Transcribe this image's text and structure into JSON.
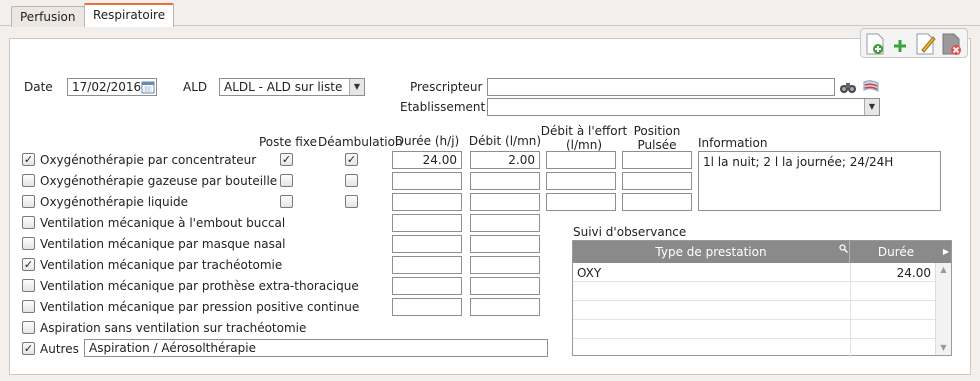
{
  "tabs": [
    {
      "label": "Perfusion"
    },
    {
      "label": "Respiratoire"
    }
  ],
  "form": {
    "date_label": "Date",
    "date_value": "17/02/2016",
    "ald_label": "ALD",
    "ald_value": "ALDL - ALD sur liste",
    "prescripteur_label": "Prescripteur",
    "prescripteur_value": "",
    "etablissement_label": "Etablissement",
    "etablissement_value": ""
  },
  "headers": {
    "poste_fixe": "Poste fixe",
    "deambulation": "Déambulation",
    "duree": "Durée (h/j)",
    "debit": "Débit (l/mn)",
    "debit_effort_line1": "Débit à l'effort",
    "debit_effort_line2": "(l/mn)",
    "position_line1": "Position",
    "position_line2": "Pulsée",
    "information": "Information"
  },
  "rows": [
    {
      "label": "Oxygénothérapie par concentrateur",
      "checked": "✓",
      "poste_fixe": "✓",
      "deambulation": "✓",
      "duree": "24.00",
      "debit": "2.00",
      "debit_effort": "",
      "position": ""
    },
    {
      "label": "Oxygénothérapie gazeuse par bouteille",
      "checked": "",
      "poste_fixe": "",
      "deambulation": "",
      "duree": "",
      "debit": "",
      "debit_effort": "",
      "position": ""
    },
    {
      "label": "Oxygénothérapie liquide",
      "checked": "",
      "poste_fixe": "",
      "deambulation": "",
      "duree": "",
      "debit": "",
      "debit_effort": "",
      "position": ""
    },
    {
      "label": "Ventilation mécanique à l'embout buccal",
      "checked": "",
      "duree": "",
      "debit": ""
    },
    {
      "label": "Ventilation mécanique par masque nasal",
      "checked": "",
      "duree": "",
      "debit": ""
    },
    {
      "label": "Ventilation mécanique par trachéotomie",
      "checked": "✓",
      "duree": "",
      "debit": ""
    },
    {
      "label": "Ventilation mécanique par prothèse extra-thoracique",
      "checked": "",
      "duree": "",
      "debit": ""
    },
    {
      "label": "Ventilation mécanique par pression positive continue",
      "checked": "",
      "duree": "",
      "debit": ""
    },
    {
      "label": "Aspiration sans ventilation sur trachéotomie",
      "checked": ""
    },
    {
      "label": "Autres",
      "checked": "✓",
      "autres_value": "Aspiration / Aérosolthérapie"
    }
  ],
  "information_value": "1l la nuit; 2 l la journée; 24/24H",
  "observance": {
    "title": "Suivi d'observance",
    "col_type": "Type de prestation",
    "col_duree": "Durée",
    "rows": [
      {
        "type": "OXY",
        "duree": "24.00"
      },
      {
        "type": "",
        "duree": ""
      },
      {
        "type": "",
        "duree": ""
      },
      {
        "type": "",
        "duree": ""
      },
      {
        "type": "",
        "duree": ""
      }
    ]
  },
  "icons": {
    "toolbar": [
      "add-document-icon",
      "edit-document-icon",
      "delete-document-icon"
    ],
    "search": "binoculars-icon",
    "flag": "flag-icon",
    "calendar": "calendar-icon"
  },
  "colors": {
    "accent": "#e8703a",
    "add": "#3aa23a",
    "delete": "#d9534f"
  }
}
